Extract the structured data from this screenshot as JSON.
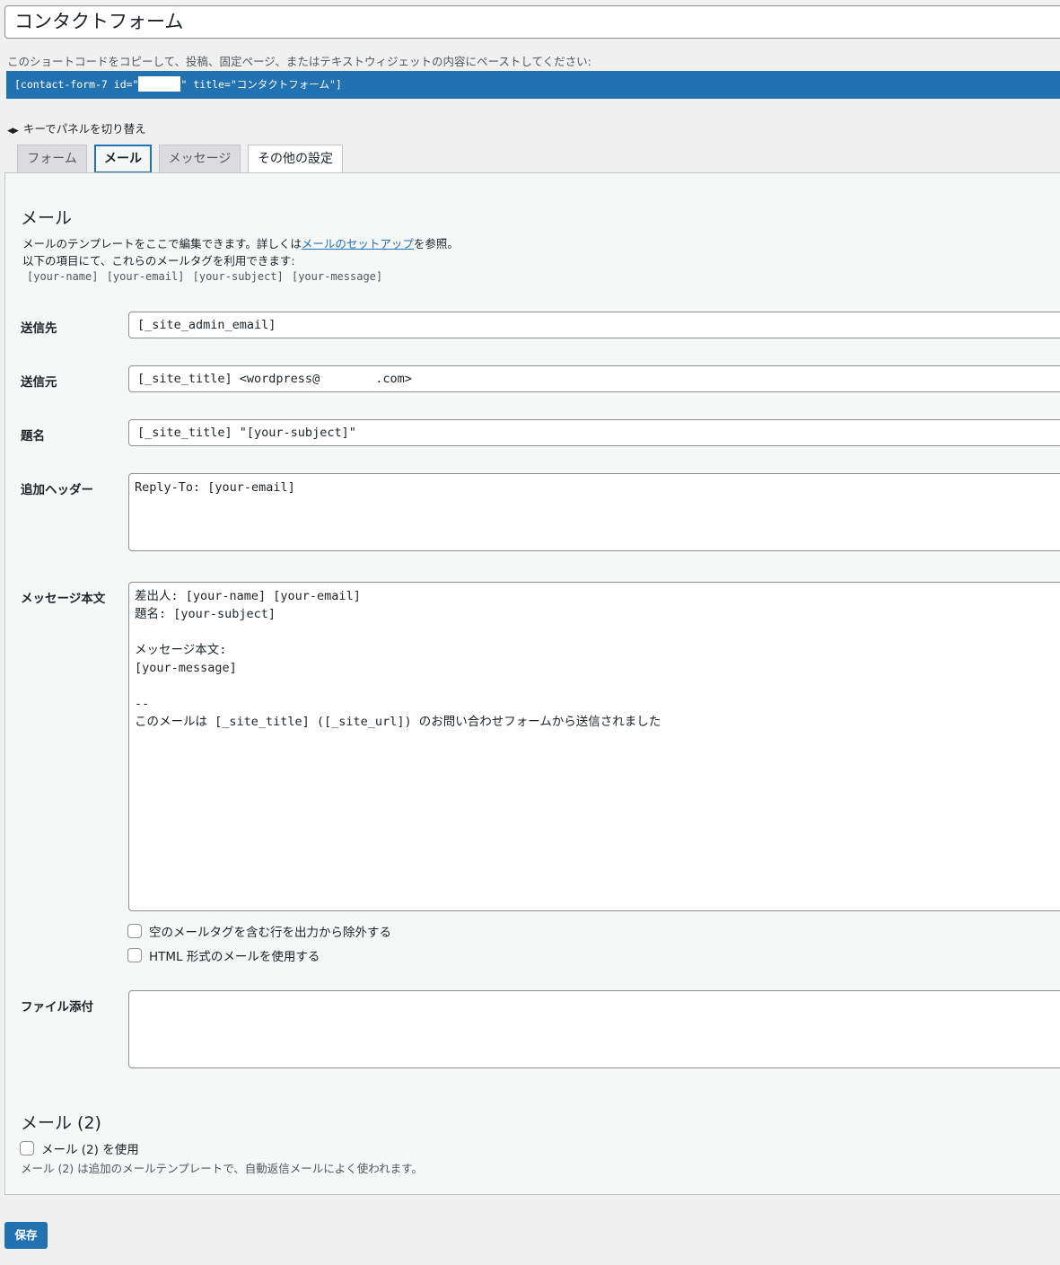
{
  "form_title": "コンタクトフォーム",
  "shortcode": {
    "note": "このショートコードをコピーして、投稿、固定ページ、またはテキストウィジェットの内容にペーストしてください:",
    "prefix": "[contact-form-7 id=\"",
    "suffix": "\" title=\"コンタクトフォーム\"]"
  },
  "keyhint": "キーでパネルを切り替え",
  "tabs": [
    "フォーム",
    "メール",
    "メッセージ",
    "その他の設定"
  ],
  "mail": {
    "heading": "メール",
    "desc_before_link": "メールのテンプレートをここで編集できます。詳しくは",
    "desc_link": "メールのセットアップ",
    "desc_after_link": "を参照。",
    "desc_line2": "以下の項目にて、これらのメールタグを利用できます:",
    "tags": "[your-name] [your-email] [your-subject] [your-message]",
    "fields": {
      "to_label": "送信先",
      "to_value": "[_site_admin_email]",
      "from_label": "送信元",
      "from_value_before": "[_site_title] <wordpress@",
      "from_value_after": ".com>",
      "subject_label": "題名",
      "subject_value": "[_site_title] \"[your-subject]\"",
      "headers_label": "追加ヘッダー",
      "headers_value": "Reply-To: [your-email]",
      "body_label": "メッセージ本文",
      "body_value": "差出人: [your-name] [your-email]\n題名: [your-subject]\n\nメッセージ本文:\n[your-message]\n\n-- \nこのメールは [_site_title] ([_site_url]) のお問い合わせフォームから送信されました",
      "attach_label": "ファイル添付",
      "attach_value": ""
    },
    "exclude_blank_label": "空のメールタグを含む行を出力から除外する",
    "use_html_label": "HTML 形式のメールを使用する"
  },
  "mail2": {
    "heading": "メール (2)",
    "use_label": "メール (2) を使用",
    "desc": "メール (2) は追加のメールテンプレートで、自動返信メールによく使われます。"
  },
  "save_label": "保存"
}
